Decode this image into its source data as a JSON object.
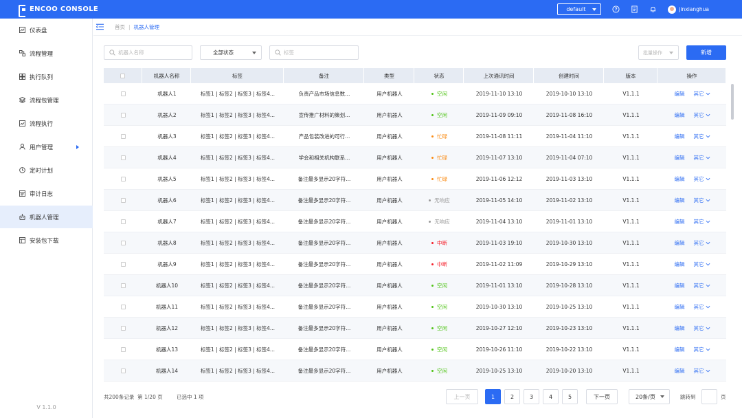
{
  "header": {
    "logo_text": "ENCOO CONSOLE",
    "tenant": "default",
    "user": "jinxianghua",
    "brand_color": "#2b6bf3"
  },
  "sidebar": {
    "items": [
      {
        "label": "仪表盘",
        "icon": "dashboard-icon"
      },
      {
        "label": "流程管理",
        "icon": "flow-icon"
      },
      {
        "label": "执行队列",
        "icon": "queue-icon"
      },
      {
        "label": "流程包管理",
        "icon": "package-icon"
      },
      {
        "label": "流程执行",
        "icon": "execute-icon"
      },
      {
        "label": "用户管理",
        "icon": "user-icon"
      },
      {
        "label": "定时计划",
        "icon": "clock-icon"
      },
      {
        "label": "审计日志",
        "icon": "log-icon"
      },
      {
        "label": "机器人管理",
        "icon": "robot-icon"
      },
      {
        "label": "安装包下载",
        "icon": "download-icon"
      }
    ],
    "active_index": 8,
    "version": "V 1.1.0"
  },
  "breadcrumb": {
    "home": "首页",
    "separator": "|",
    "current": "机器人管理"
  },
  "filters": {
    "name_placeholder": "机器人名称",
    "status_value": "全部状态",
    "tag_placeholder": "标签",
    "batch_placeholder": "批量操作",
    "new_button": "新增"
  },
  "table": {
    "columns": [
      "",
      "机器人名称",
      "标签",
      "备注",
      "类型",
      "状态",
      "上次通讯时间",
      "创建时间",
      "版本",
      "操作"
    ],
    "edit_label": "编辑",
    "more_label": "其它",
    "rows": [
      {
        "name": "机器人1",
        "tags": "标签1 | 标签2 | 标签3 | 标签4...",
        "note": "负责产品市场信息数...",
        "type": "用户机器人",
        "status": "空闲",
        "last_comm": "2019-11-10 13:10",
        "created": "2019-10-10 13:10",
        "version": "V1.1.1"
      },
      {
        "name": "机器人2",
        "tags": "标签1 | 标签2 | 标签3 | 标签4...",
        "note": "宣传推广材料的策划...",
        "type": "用户机器人",
        "status": "空闲",
        "last_comm": "2019-11-09 09:10",
        "created": "2019-11-08 16:10",
        "version": "V1.1.1"
      },
      {
        "name": "机器人3",
        "tags": "标签1 | 标签2 | 标签3 | 标签4...",
        "note": "产品包装改进的可行...",
        "type": "用户机器人",
        "status": "忙碌",
        "last_comm": "2019-11-08 11:11",
        "created": "2019-11-04 11:10",
        "version": "V1.1.1"
      },
      {
        "name": "机器人4",
        "tags": "标签1 | 标签2 | 标签3 | 标签4...",
        "note": "学会和相关机构联系...",
        "type": "用户机器人",
        "status": "忙碌",
        "last_comm": "2019-11-07 13:10",
        "created": "2019-11-04 07:10",
        "version": "V1.1.1"
      },
      {
        "name": "机器人5",
        "tags": "标签1 | 标签2 | 标签3 | 标签4...",
        "note": "备注最多显示20字符...",
        "type": "用户机器人",
        "status": "忙碌",
        "last_comm": "2019-11-06 12:12",
        "created": "2019-11-03 13:10",
        "version": "V1.1.1"
      },
      {
        "name": "机器人6",
        "tags": "标签1 | 标签2 | 标签3 | 标签4...",
        "note": "备注最多显示20字符...",
        "type": "用户机器人",
        "status": "无响应",
        "last_comm": "2019-11-05 14:10",
        "created": "2019-11-02 13:10",
        "version": "V1.1.1"
      },
      {
        "name": "机器人7",
        "tags": "标签1 | 标签2 | 标签3 | 标签4...",
        "note": "备注最多显示20字符...",
        "type": "用户机器人",
        "status": "无响应",
        "last_comm": "2019-11-04 13:10",
        "created": "2019-11-01 13:10",
        "version": "V1.1.1"
      },
      {
        "name": "机器人8",
        "tags": "标签1 | 标签2 | 标签3 | 标签4...",
        "note": "备注最多显示20字符...",
        "type": "用户机器人",
        "status": "中断",
        "last_comm": "2019-11-03 19:10",
        "created": "2019-10-30 13:10",
        "version": "V1.1.1"
      },
      {
        "name": "机器人9",
        "tags": "标签1 | 标签2 | 标签3 | 标签4...",
        "note": "备注最多显示20字符...",
        "type": "用户机器人",
        "status": "中断",
        "last_comm": "2019-11-02 11:09",
        "created": "2019-10-29 13:10",
        "version": "V1.1.1"
      },
      {
        "name": "机器人10",
        "tags": "标签1 | 标签2 | 标签3 | 标签4...",
        "note": "备注最多显示20字符...",
        "type": "用户机器人",
        "status": "空闲",
        "last_comm": "2019-11-01 13:10",
        "created": "2019-10-28 13:10",
        "version": "V1.1.1"
      },
      {
        "name": "机器人11",
        "tags": "标签1 | 标签2 | 标签3 | 标签4...",
        "note": "备注最多显示20字符...",
        "type": "用户机器人",
        "status": "空闲",
        "last_comm": "2019-10-30 13:10",
        "created": "2019-10-25 13:10",
        "version": "V1.1.1"
      },
      {
        "name": "机器人12",
        "tags": "标签1 | 标签2 | 标签3 | 标签4...",
        "note": "备注最多显示20字符...",
        "type": "用户机器人",
        "status": "空闲",
        "last_comm": "2019-10-27 12:10",
        "created": "2019-10-23 13:10",
        "version": "V1.1.1"
      },
      {
        "name": "机器人13",
        "tags": "标签1 | 标签2 | 标签3 | 标签4...",
        "note": "备注最多显示20字符...",
        "type": "用户机器人",
        "status": "空闲",
        "last_comm": "2019-10-26 11:10",
        "created": "2019-10-22 13:10",
        "version": "V1.1.1"
      },
      {
        "name": "机器人14",
        "tags": "标签1 | 标签2 | 标签3 | 标签4...",
        "note": "备注最多显示20字符...",
        "type": "用户机器人",
        "status": "空闲",
        "last_comm": "2019-10-25 13:10",
        "created": "2019-10-20 13:10",
        "version": "V1.1.1"
      }
    ],
    "status_colors": {
      "空闲": "#52c41a",
      "忙碌": "#fa8c16",
      "无响应": "#999999",
      "中断": "#f5222d"
    }
  },
  "footer": {
    "total": "共200条记录",
    "page_info": "第 1/20 页",
    "selected": "已选中 1 项",
    "prev": "上一页",
    "pages": [
      "1",
      "2",
      "3",
      "4",
      "5"
    ],
    "current_page": "1",
    "next": "下一页",
    "page_size": "20条/页",
    "jump_label": "跳转到",
    "jump_unit": "页"
  }
}
